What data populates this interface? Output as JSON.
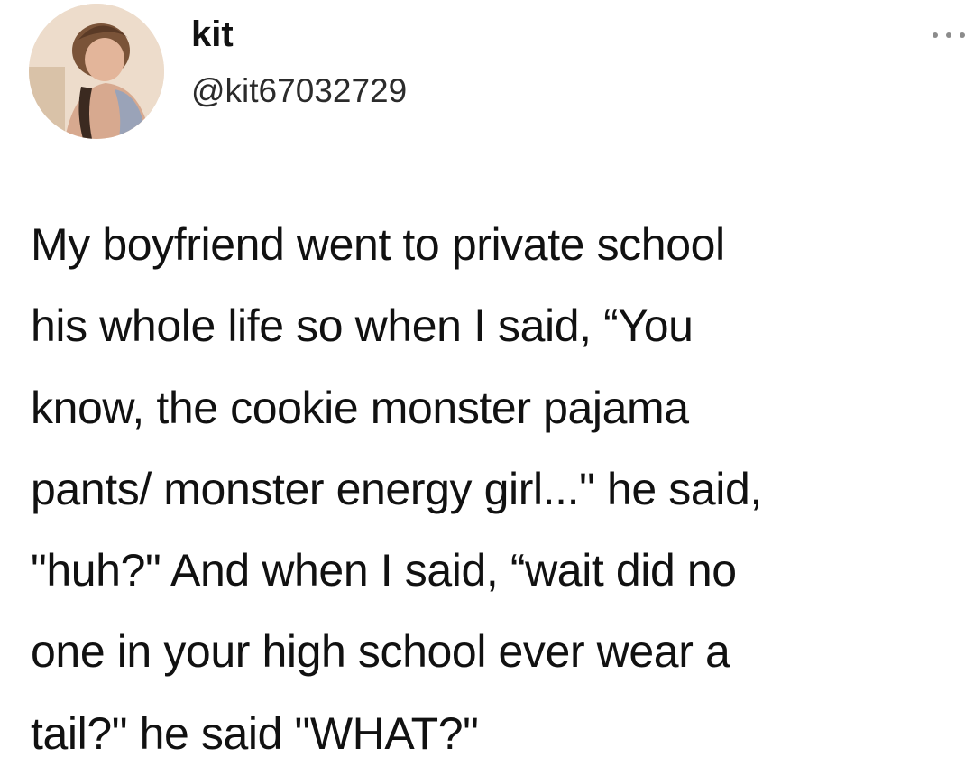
{
  "tweet": {
    "author": {
      "display_name": "kit",
      "handle": "@kit67032729",
      "avatar_icon": "avatar-photo"
    },
    "more_icon": "more-horizontal-icon",
    "text_lines": [
      "My boyfriend went to private school",
      "his whole life so when I said, “You",
      "know, the cookie monster pajama",
      "pants/ monster energy girl...\" he said,",
      "\"huh?\" And when I said, “wait did no",
      "one in your high school ever wear a",
      "tail?\" he said \"WHAT?\""
    ]
  }
}
